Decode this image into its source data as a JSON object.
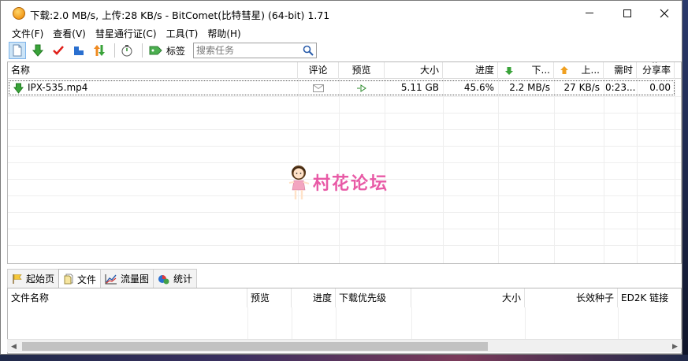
{
  "window": {
    "title": "下载:2.0 MB/s, 上传:28 KB/s - BitComet(比特彗星) (64-bit) 1.71"
  },
  "menu": [
    "文件(F)",
    "查看(V)",
    "彗星通行证(C)",
    "工具(T)",
    "帮助(H)"
  ],
  "toolbar": {
    "tag_label": "标签",
    "search_placeholder": "搜索任务"
  },
  "tasklist": {
    "columns": [
      "名称",
      "评论",
      "预览",
      "大小",
      "进度",
      "下...",
      "上...",
      "需时",
      "分享率"
    ],
    "rows": [
      {
        "name": "IPX-535.mp4",
        "size": "5.11 GB",
        "progress": "45.6%",
        "down_speed": "2.2 MB/s",
        "up_speed": "27 KB/s",
        "eta": "0:23...",
        "ratio": "0.00"
      }
    ]
  },
  "watermark": {
    "text": "村花论坛"
  },
  "bottom_tabs": [
    "起始页",
    "文件",
    "流量图",
    "统计"
  ],
  "filelist": {
    "columns": [
      "文件名称",
      "预览",
      "进度",
      "下载优先级",
      "大小",
      "长效种子",
      "ED2K 链接"
    ]
  },
  "colors": {
    "watermark": "#e85aa6",
    "download_arrow": "#3aa33a",
    "upload_arrow": "#f0a020"
  }
}
